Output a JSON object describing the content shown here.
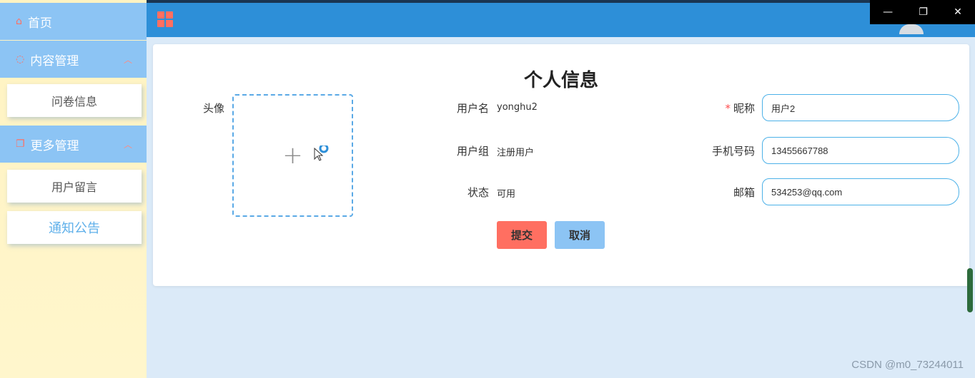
{
  "sidebar": {
    "home": {
      "label": "首页",
      "icon": "home-icon"
    },
    "groups": [
      {
        "label": "内容管理",
        "icon": "message-icon",
        "items": [
          "问卷信息"
        ]
      },
      {
        "label": "更多管理",
        "icon": "copy-icon",
        "items": [
          "用户留言",
          "通知公告"
        ]
      }
    ],
    "active_item": "通知公告"
  },
  "header": {
    "menu_icon": "grid-menu-icon",
    "window_controls": [
      "—",
      "❐",
      "✕"
    ]
  },
  "form": {
    "title": "个人信息",
    "avatar_label": "头像",
    "username_label": "用户名",
    "username_value": "yonghu2",
    "group_label": "用户组",
    "group_value": "注册用户",
    "status_label": "状态",
    "status_value": "可用",
    "nickname_label": "昵称",
    "nickname_value": "用户2",
    "phone_label": "手机号码",
    "phone_value": "13455667788",
    "email_label": "邮箱",
    "email_value": "534253@qq.com",
    "submit_label": "提交",
    "cancel_label": "取消"
  },
  "watermark": "CSDN @m0_73244011",
  "colors": {
    "primary": "#2d8fd8",
    "sidebar_header": "#8cc4f4",
    "accent": "#ff6f61",
    "sidebar_bg": "#fff3c2"
  }
}
